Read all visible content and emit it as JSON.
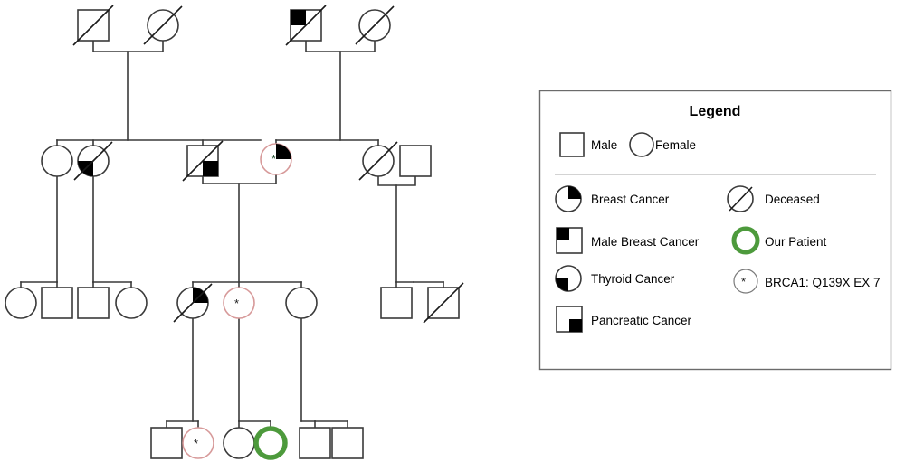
{
  "figure": {
    "type": "pedigree-chart",
    "title": "",
    "generations": 4,
    "line_color": "#3a3a3a",
    "symbol_stroke": "#3a3a3a",
    "fill_color": "#000000",
    "carrier_outline_color": "#d79a9a",
    "proband_outline_color": "#4d9a3c",
    "background": "#ffffff"
  },
  "legend": {
    "title": "Legend",
    "box": {
      "border_color": "#6b6b6b",
      "divider_color": "#b9b9b9"
    },
    "sex_row": [
      {
        "icon": "square-outline-icon",
        "label": "Male"
      },
      {
        "icon": "circle-outline-icon",
        "label": "Female"
      }
    ],
    "left_column": [
      {
        "icon": "circle-upper-right-filled-icon",
        "label": "Breast Cancer"
      },
      {
        "icon": "square-upper-left-filled-icon",
        "label": "Male Breast Cancer"
      },
      {
        "icon": "circle-lower-left-filled-icon",
        "label": "Thyroid Cancer"
      },
      {
        "icon": "square-lower-right-filled-icon",
        "label": "Pancreatic Cancer"
      }
    ],
    "right_column": [
      {
        "icon": "circle-slash-icon",
        "label": "Deceased"
      },
      {
        "icon": "circle-green-thick-icon",
        "label": "Our Patient"
      },
      {
        "icon": "circle-asterisk-icon",
        "label": "BRCA1: Q139X EX 7"
      }
    ]
  },
  "pedigree": {
    "generation_1": [
      {
        "id": "I-1",
        "sex": "male",
        "deceased": true,
        "conditions": [],
        "carrier": false,
        "proband": false
      },
      {
        "id": "I-2",
        "sex": "female",
        "deceased": true,
        "conditions": [],
        "carrier": false,
        "proband": false
      },
      {
        "id": "I-3",
        "sex": "male",
        "deceased": true,
        "conditions": [
          "Male Breast Cancer"
        ],
        "carrier": false,
        "proband": false
      },
      {
        "id": "I-4",
        "sex": "female",
        "deceased": true,
        "conditions": [],
        "carrier": false,
        "proband": false
      }
    ],
    "generation_2": [
      {
        "id": "II-1",
        "sex": "female",
        "deceased": false,
        "conditions": [],
        "carrier": false,
        "proband": false
      },
      {
        "id": "II-2",
        "sex": "female",
        "deceased": true,
        "conditions": [
          "Thyroid Cancer"
        ],
        "carrier": false,
        "proband": false
      },
      {
        "id": "II-3",
        "sex": "male",
        "deceased": true,
        "conditions": [
          "Pancreatic Cancer"
        ],
        "carrier": false,
        "proband": false
      },
      {
        "id": "II-4",
        "sex": "female",
        "deceased": false,
        "conditions": [
          "Breast Cancer"
        ],
        "carrier": true,
        "proband": false
      },
      {
        "id": "II-5",
        "sex": "female",
        "deceased": true,
        "conditions": [],
        "carrier": false,
        "proband": false
      },
      {
        "id": "II-6",
        "sex": "male",
        "deceased": false,
        "conditions": [],
        "carrier": false,
        "proband": false
      }
    ],
    "generation_3": [
      {
        "id": "III-1",
        "sex": "female",
        "deceased": false,
        "conditions": [],
        "carrier": false,
        "proband": false
      },
      {
        "id": "III-2",
        "sex": "male",
        "deceased": false,
        "conditions": [],
        "carrier": false,
        "proband": false
      },
      {
        "id": "III-3",
        "sex": "male",
        "deceased": false,
        "conditions": [],
        "carrier": false,
        "proband": false
      },
      {
        "id": "III-4",
        "sex": "female",
        "deceased": false,
        "conditions": [],
        "carrier": false,
        "proband": false
      },
      {
        "id": "III-5",
        "sex": "female",
        "deceased": true,
        "conditions": [
          "Breast Cancer"
        ],
        "carrier": false,
        "proband": false
      },
      {
        "id": "III-6",
        "sex": "female",
        "deceased": false,
        "conditions": [],
        "carrier": true,
        "proband": false
      },
      {
        "id": "III-7",
        "sex": "female",
        "deceased": false,
        "conditions": [],
        "carrier": false,
        "proband": false
      },
      {
        "id": "III-8",
        "sex": "male",
        "deceased": false,
        "conditions": [],
        "carrier": false,
        "proband": false
      },
      {
        "id": "III-9",
        "sex": "male",
        "deceased": true,
        "conditions": [],
        "carrier": false,
        "proband": false
      }
    ],
    "generation_4": [
      {
        "id": "IV-1",
        "sex": "male",
        "deceased": false,
        "conditions": [],
        "carrier": false,
        "proband": false
      },
      {
        "id": "IV-2",
        "sex": "female",
        "deceased": false,
        "conditions": [],
        "carrier": true,
        "proband": false
      },
      {
        "id": "IV-3",
        "sex": "female",
        "deceased": false,
        "conditions": [],
        "carrier": false,
        "proband": false
      },
      {
        "id": "IV-4",
        "sex": "female",
        "deceased": false,
        "conditions": [],
        "carrier": false,
        "proband": true
      },
      {
        "id": "IV-5",
        "sex": "male",
        "deceased": false,
        "conditions": [],
        "carrier": false,
        "proband": false
      },
      {
        "id": "IV-6",
        "sex": "male",
        "deceased": false,
        "conditions": [],
        "carrier": false,
        "proband": false
      }
    ]
  }
}
